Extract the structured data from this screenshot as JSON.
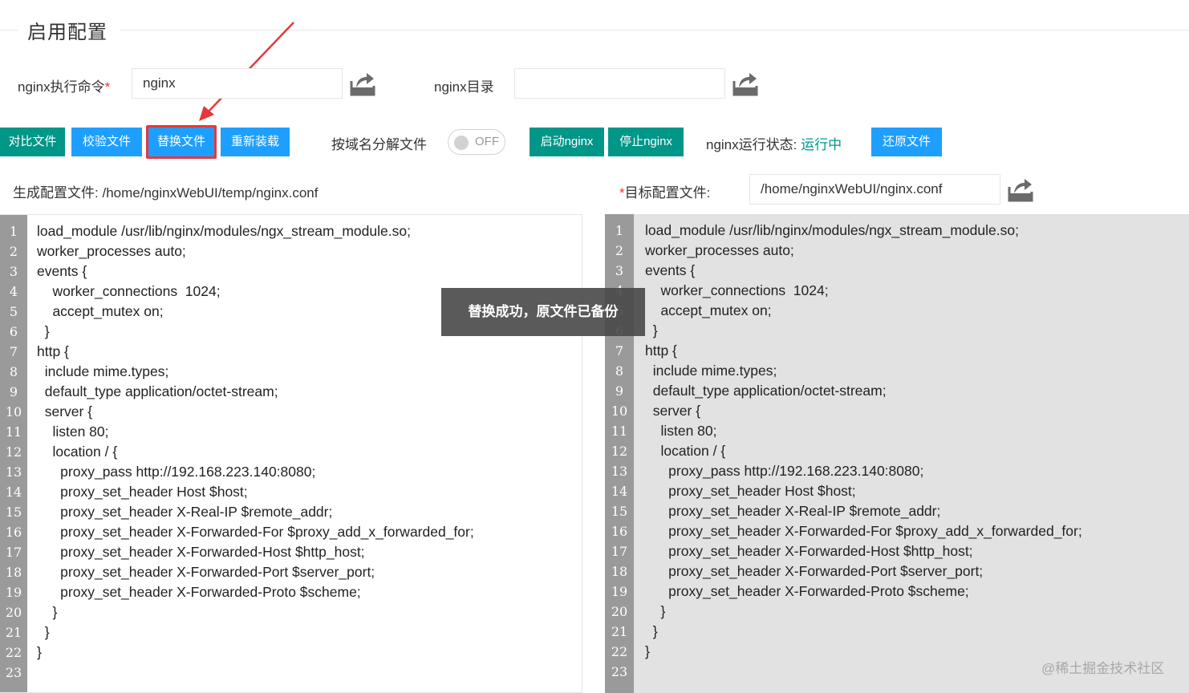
{
  "section": {
    "title": "启用配置"
  },
  "form": {
    "cmd_label": "nginx执行命令",
    "cmd_required_mark": "*",
    "cmd_value": "nginx",
    "dir_label": "nginx目录",
    "dir_value": ""
  },
  "toolbar": {
    "compare_label": "对比文件",
    "validate_label": "校验文件",
    "replace_label": "替换文件",
    "reload_label": "重新装载",
    "split_label": "按域名分解文件",
    "split_switch_text": "OFF",
    "start_label": "启动nginx",
    "stop_label": "停止nginx",
    "status_label": "nginx运行状态:",
    "status_value": "运行中",
    "restore_label": "还原文件"
  },
  "colors": {
    "green_button": "#009688",
    "blue_button": "#1e9fff",
    "highlight_red": "#e4393c",
    "status_running": "#009688"
  },
  "paths": {
    "generated_label": "生成配置文件:",
    "generated_value": "/home/nginxWebUI/temp/nginx.conf",
    "target_required_mark": "*",
    "target_label": "目标配置文件:",
    "target_value": "/home/nginxWebUI/nginx.conf"
  },
  "icons": {
    "cmd_upload": "upload-icon",
    "dir_upload": "upload-icon",
    "target_upload": "upload-icon"
  },
  "toast": {
    "message": "替换成功，原文件已备份"
  },
  "editor_left": {
    "line_numbers": [
      "1",
      "2",
      "3",
      "4",
      "5",
      "6",
      "7",
      "8",
      "9",
      "10",
      "11",
      "12",
      "13",
      "14",
      "15",
      "16",
      "17",
      "18",
      "19",
      "20",
      "21",
      "22",
      "23"
    ],
    "lines": [
      "load_module /usr/lib/nginx/modules/ngx_stream_module.so;",
      "worker_processes auto;",
      "events {",
      "    worker_connections  1024;",
      "    accept_mutex on;",
      "  }",
      "http {",
      "  include mime.types;",
      "  default_type application/octet-stream;",
      "  server {",
      "    listen 80;",
      "    location / {",
      "      proxy_pass http://192.168.223.140:8080;",
      "      proxy_set_header Host $host;",
      "      proxy_set_header X-Real-IP $remote_addr;",
      "      proxy_set_header X-Forwarded-For $proxy_add_x_forwarded_for;",
      "      proxy_set_header X-Forwarded-Host $http_host;",
      "      proxy_set_header X-Forwarded-Port $server_port;",
      "      proxy_set_header X-Forwarded-Proto $scheme;",
      "    }",
      "  }",
      "}",
      ""
    ]
  },
  "editor_right": {
    "line_numbers": [
      "1",
      "2",
      "3",
      "4",
      "5",
      "6",
      "7",
      "8",
      "9",
      "10",
      "11",
      "12",
      "13",
      "14",
      "15",
      "16",
      "17",
      "18",
      "19",
      "20",
      "21",
      "22",
      "23"
    ],
    "lines": [
      "load_module /usr/lib/nginx/modules/ngx_stream_module.so;",
      "worker_processes auto;",
      "events {",
      "    worker_connections  1024;",
      "    accept_mutex on;",
      "  }",
      "http {",
      "  include mime.types;",
      "  default_type application/octet-stream;",
      "  server {",
      "    listen 80;",
      "    location / {",
      "      proxy_pass http://192.168.223.140:8080;",
      "      proxy_set_header Host $host;",
      "      proxy_set_header X-Real-IP $remote_addr;",
      "      proxy_set_header X-Forwarded-For $proxy_add_x_forwarded_for;",
      "      proxy_set_header X-Forwarded-Host $http_host;",
      "      proxy_set_header X-Forwarded-Port $server_port;",
      "      proxy_set_header X-Forwarded-Proto $scheme;",
      "    }",
      "  }",
      "}",
      ""
    ]
  },
  "watermark": "@稀土掘金技术社区"
}
